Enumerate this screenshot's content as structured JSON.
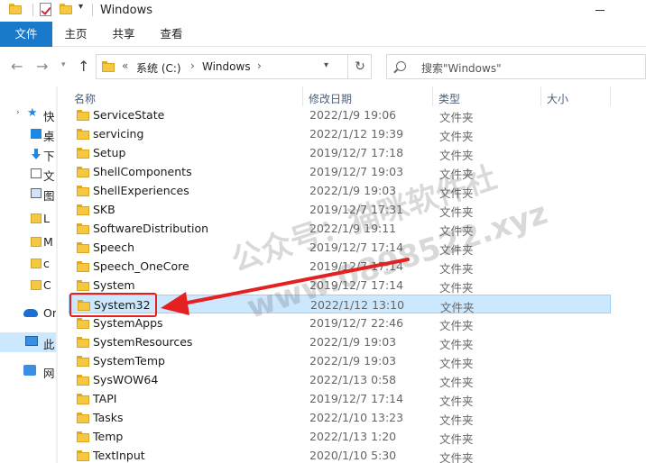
{
  "window": {
    "title": "Windows"
  },
  "ribbon": {
    "tabs": [
      "文件",
      "主页",
      "共享",
      "查看"
    ]
  },
  "address": {
    "chevron": "«",
    "drive": "系统 (C:)",
    "folder": "Windows",
    "refresh": "↻"
  },
  "search": {
    "placeholder": "搜索\"Windows\""
  },
  "navpane": {
    "items": [
      {
        "label": "快",
        "icon": "star-icon"
      },
      {
        "label": "桌",
        "icon": "desktop-icon"
      },
      {
        "label": "下",
        "icon": "download-icon"
      },
      {
        "label": "文",
        "icon": "document-icon"
      },
      {
        "label": "图",
        "icon": "picture-icon"
      },
      {
        "label": "L",
        "icon": "folder-icon"
      },
      {
        "label": "M",
        "icon": "folder-icon"
      },
      {
        "label": "c",
        "icon": "folder-icon"
      },
      {
        "label": "C",
        "icon": "folder-icon"
      },
      {
        "label": "On",
        "icon": "onedrive-icon"
      },
      {
        "label": "此",
        "icon": "this-pc-icon"
      },
      {
        "label": "网",
        "icon": "network-icon"
      }
    ]
  },
  "columns": {
    "name": "名称",
    "date": "修改日期",
    "type": "类型",
    "size": "大小"
  },
  "files": [
    {
      "name": "ServiceState",
      "date": "2022/1/9 19:06",
      "type": "文件夹"
    },
    {
      "name": "servicing",
      "date": "2022/1/12 19:39",
      "type": "文件夹"
    },
    {
      "name": "Setup",
      "date": "2019/12/7 17:18",
      "type": "文件夹"
    },
    {
      "name": "ShellComponents",
      "date": "2019/12/7 19:03",
      "type": "文件夹"
    },
    {
      "name": "ShellExperiences",
      "date": "2022/1/9 19:03",
      "type": "文件夹"
    },
    {
      "name": "SKB",
      "date": "2019/12/7 17:31",
      "type": "文件夹"
    },
    {
      "name": "SoftwareDistribution",
      "date": "2022/1/9 19:11",
      "type": "文件夹"
    },
    {
      "name": "Speech",
      "date": "2019/12/7 17:14",
      "type": "文件夹"
    },
    {
      "name": "Speech_OneCore",
      "date": "2019/12/7 17:14",
      "type": "文件夹"
    },
    {
      "name": "System",
      "date": "2019/12/7 17:14",
      "type": "文件夹"
    },
    {
      "name": "System32",
      "date": "2022/1/12 13:10",
      "type": "文件夹",
      "selected": true
    },
    {
      "name": "SystemApps",
      "date": "2019/12/7 22:46",
      "type": "文件夹"
    },
    {
      "name": "SystemResources",
      "date": "2022/1/9 19:03",
      "type": "文件夹"
    },
    {
      "name": "SystemTemp",
      "date": "2022/1/9 19:03",
      "type": "文件夹"
    },
    {
      "name": "SysWOW64",
      "date": "2022/1/13 0:58",
      "type": "文件夹"
    },
    {
      "name": "TAPI",
      "date": "2019/12/7 17:14",
      "type": "文件夹"
    },
    {
      "name": "Tasks",
      "date": "2022/1/10 13:23",
      "type": "文件夹"
    },
    {
      "name": "Temp",
      "date": "2022/1/13 1:20",
      "type": "文件夹"
    },
    {
      "name": "TextInput",
      "date": "2020/1/10 5:30",
      "type": "文件夹"
    }
  ],
  "watermark": {
    "line1": "公众号：猫咪软件社",
    "line2": "www.0898522.xyz"
  },
  "colors": {
    "accent": "#1979ca",
    "selection": "#cce8ff",
    "highlight": "#e52020"
  }
}
